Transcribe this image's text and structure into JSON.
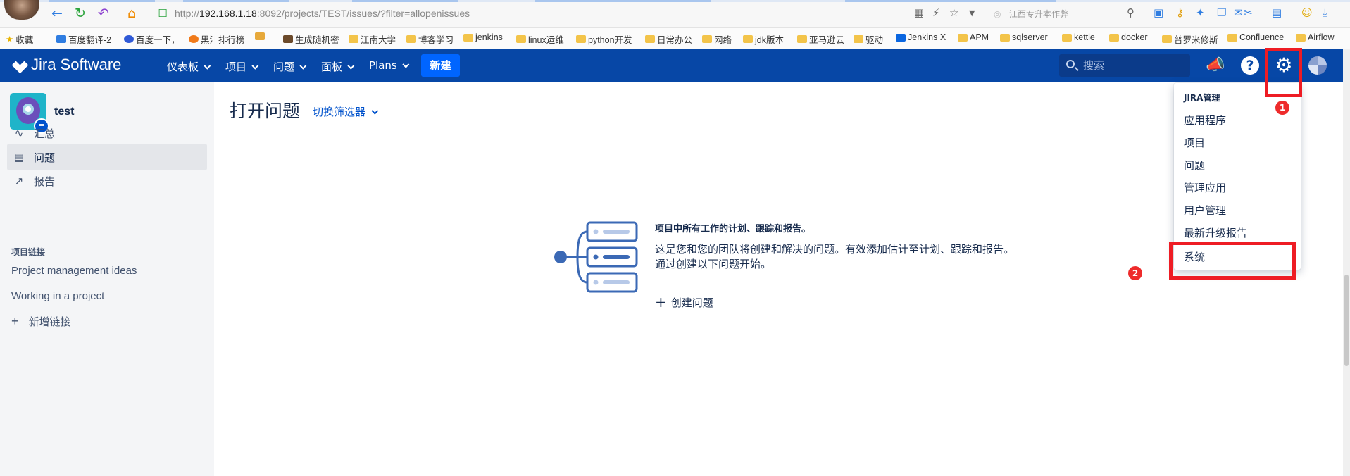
{
  "browser": {
    "url_prefix": "http://",
    "url_host": "192.168.1.18",
    "url_rest": ":8092/projects/TEST/issues/?filter=allopenissues",
    "search_placeholder": "江西专升本作弊",
    "bookmarks": [
      "收藏",
      "百度翻译-2",
      "百度一下，",
      "黑汁排行榜",
      "生成随机密",
      "江南大学",
      "博客学习",
      "jenkins",
      "linux运维",
      "python开发",
      "日常办公",
      "网络",
      "jdk版本",
      "亚马逊云",
      "驱动",
      "Jenkins X",
      "APM",
      "sqlserver",
      "kettle",
      "docker",
      "普罗米修斯",
      "Confluence",
      "Airflow"
    ]
  },
  "header": {
    "logo": "Jira Software",
    "nav": [
      "仪表板",
      "项目",
      "问题",
      "面板",
      "Plans"
    ],
    "create_label": "新建",
    "search_placeholder": "搜索",
    "help_glyph": "?"
  },
  "sidebar": {
    "project_name": "test",
    "items": [
      {
        "label": "汇总",
        "icon": "activity-icon"
      },
      {
        "label": "问题",
        "icon": "issues-icon"
      },
      {
        "label": "报告",
        "icon": "reports-icon"
      }
    ],
    "links_heading": "项目链接",
    "links": [
      "Project management ideas",
      "Working in a project"
    ],
    "add_link": "新增链接"
  },
  "main": {
    "title": "打开问题",
    "filter_switch": "切换筛选器",
    "right_partial": "选器",
    "empty_title": "项目中所有工作的计划、跟踪和报告。",
    "empty_desc": "这是您和您的团队将创建和解决的问题。有效添加估计至计划、跟踪和报告。通过创建以下问题开始。",
    "create_issue": "创建问题"
  },
  "admin_menu": {
    "heading": "JIRA管理",
    "items": [
      "应用程序",
      "项目",
      "问题",
      "管理应用",
      "用户管理",
      "最新升级报告",
      "系统"
    ]
  },
  "annotations": {
    "badge1": "1",
    "badge2": "2",
    "color": "#ee1c24"
  }
}
